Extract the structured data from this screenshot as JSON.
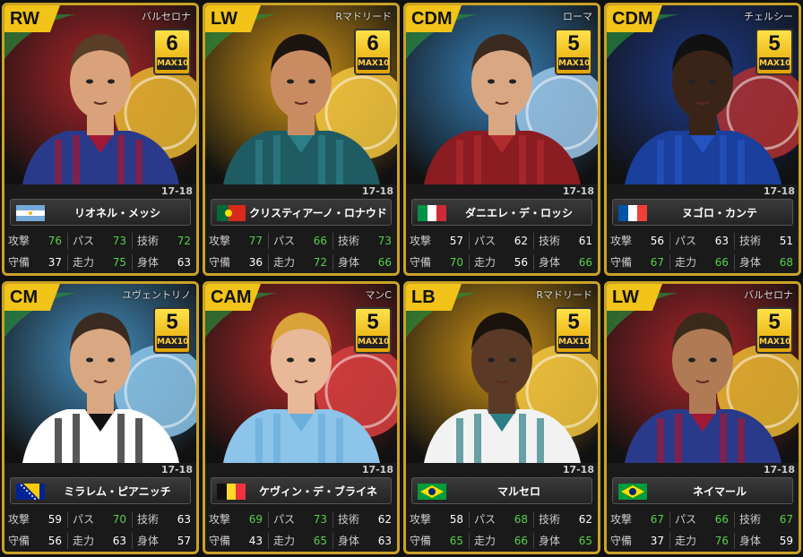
{
  "stat_labels": {
    "atk": "攻撃",
    "pas": "パス",
    "tec": "技術",
    "def": "守備",
    "run": "走力",
    "phy": "身体"
  },
  "max_label": "MAX10",
  "cards": [
    {
      "pos": "RW",
      "club": "バルセロナ",
      "rating": "6",
      "season": "17-18",
      "name": "リオネル・メッシ",
      "flag": "argentina",
      "atk": "76",
      "pas": "73",
      "tec": "72",
      "def": "37",
      "run": "75",
      "phy": "63",
      "green": {
        "atk": true,
        "pas": true,
        "tec": true,
        "def": false,
        "run": true,
        "phy": false
      },
      "colors": {
        "bg": "#c0262b",
        "shirt": "#2a3a8a",
        "shirt2": "#a01836",
        "skin": "#d9a27a",
        "hair": "#5a3d26",
        "crest": "#e8b830"
      }
    },
    {
      "pos": "LW",
      "club": "Rマドリード",
      "rating": "6",
      "season": "17-18",
      "name": "クリスティアーノ・ロナウド",
      "flag": "portugal",
      "atk": "77",
      "pas": "66",
      "tec": "73",
      "def": "36",
      "run": "72",
      "phy": "66",
      "green": {
        "atk": true,
        "pas": true,
        "tec": true,
        "def": false,
        "run": true,
        "phy": true
      },
      "colors": {
        "bg": "#e6a214",
        "shirt": "#1f5b63",
        "shirt2": "#2d7f87",
        "skin": "#c98c62",
        "hair": "#1c1410",
        "crest": "#f2c640"
      }
    },
    {
      "pos": "CDM",
      "club": "ローマ",
      "rating": "5",
      "season": "17-18",
      "name": "ダニエレ・デ・ロッシ",
      "flag": "italy",
      "atk": "57",
      "pas": "62",
      "tec": "61",
      "def": "70",
      "run": "56",
      "phy": "66",
      "green": {
        "atk": false,
        "pas": false,
        "tec": false,
        "def": true,
        "run": false,
        "phy": true
      },
      "colors": {
        "bg": "#3a8fd0",
        "shirt": "#8a1c22",
        "shirt2": "#b02a2e",
        "skin": "#d9a882",
        "hair": "#3a2a20",
        "crest": "#9cc7e8"
      }
    },
    {
      "pos": "CDM",
      "club": "チェルシー",
      "rating": "5",
      "season": "17-18",
      "name": "ヌゴロ・カンテ",
      "flag": "france",
      "atk": "56",
      "pas": "63",
      "tec": "51",
      "def": "67",
      "run": "66",
      "phy": "68",
      "green": {
        "atk": false,
        "pas": false,
        "tec": false,
        "def": true,
        "run": true,
        "phy": true
      },
      "colors": {
        "bg": "#1d3f9a",
        "shirt": "#1a3f9c",
        "shirt2": "#2454c0",
        "skin": "#3a2418",
        "hair": "#111111",
        "crest": "#b03030"
      }
    },
    {
      "pos": "CM",
      "club": "ユヴェントリノ",
      "rating": "5",
      "season": "17-18",
      "name": "ミラレム・ピアニッチ",
      "flag": "bosnia",
      "atk": "59",
      "pas": "70",
      "tec": "63",
      "def": "56",
      "run": "63",
      "phy": "57",
      "green": {
        "atk": false,
        "pas": true,
        "tec": false,
        "def": false,
        "run": false,
        "phy": false
      },
      "colors": {
        "bg": "#4aa0d8",
        "shirt": "#ffffff",
        "shirt2": "#111111",
        "skin": "#d9a882",
        "hair": "#3a2a20",
        "crest": "#8cc4e8"
      }
    },
    {
      "pos": "CAM",
      "club": "マンC",
      "rating": "5",
      "season": "17-18",
      "name": "ケヴィン・デ・ブライネ",
      "flag": "belgium",
      "atk": "69",
      "pas": "73",
      "tec": "62",
      "def": "43",
      "run": "65",
      "phy": "63",
      "green": {
        "atk": true,
        "pas": true,
        "tec": false,
        "def": false,
        "run": true,
        "phy": false
      },
      "colors": {
        "bg": "#c82a2a",
        "shirt": "#8cc4ea",
        "shirt2": "#6aaedc",
        "skin": "#e8b898",
        "hair": "#d9a23a",
        "crest": "#d84040"
      }
    },
    {
      "pos": "LB",
      "club": "Rマドリード",
      "rating": "5",
      "season": "17-18",
      "name": "マルセロ",
      "flag": "brazil",
      "atk": "58",
      "pas": "68",
      "tec": "62",
      "def": "65",
      "run": "66",
      "phy": "65",
      "green": {
        "atk": false,
        "pas": true,
        "tec": false,
        "def": true,
        "run": true,
        "phy": true
      },
      "colors": {
        "bg": "#e6a214",
        "shirt": "#f2f2f2",
        "shirt2": "#2d7f87",
        "skin": "#5a3a26",
        "hair": "#1a120c",
        "crest": "#f2c640"
      }
    },
    {
      "pos": "LW",
      "club": "バルセロナ",
      "rating": "5",
      "season": "17-18",
      "name": "ネイマール",
      "flag": "brazil",
      "atk": "67",
      "pas": "66",
      "tec": "67",
      "def": "37",
      "run": "76",
      "phy": "59",
      "green": {
        "atk": true,
        "pas": true,
        "tec": true,
        "def": false,
        "run": true,
        "phy": false
      },
      "colors": {
        "bg": "#c0262b",
        "shirt": "#2a3a8a",
        "shirt2": "#a01836",
        "skin": "#b07a54",
        "hair": "#3a2a1a",
        "crest": "#e8b830"
      }
    }
  ]
}
